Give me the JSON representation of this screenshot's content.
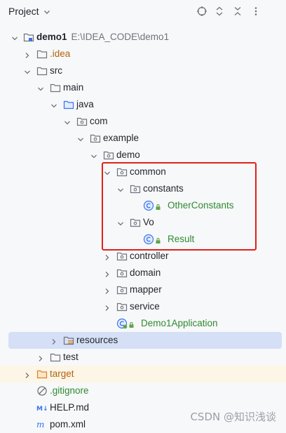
{
  "header": {
    "title": "Project",
    "icons": [
      "crosshair-icon",
      "expand-collapse-icon",
      "collapse-all-icon",
      "more-icon"
    ]
  },
  "tree": {
    "demo1": "demo1",
    "demo1_path": "E:\\IDEA_CODE\\demo1",
    "idea": ".idea",
    "src": "src",
    "main": "main",
    "java": "java",
    "com": "com",
    "example": "example",
    "demo": "demo",
    "common": "common",
    "constants": "constants",
    "other_constants": "OtherConstants",
    "vo": "Vo",
    "result": "Result",
    "controller": "controller",
    "domain": "domain",
    "mapper": "mapper",
    "service": "service",
    "demo1_application": "Demo1Application",
    "resources": "resources",
    "test": "test",
    "target": "target",
    "gitignore": ".gitignore",
    "help_md": "HELP.md",
    "pom": "pom.xml"
  },
  "watermark": "CSDN @知识浅谈",
  "colors": {
    "selection": "#d5e0f6",
    "highlight_box": "#e0201b",
    "class_green": "#2f8a2f",
    "excluded_orange": "#b3620f"
  }
}
